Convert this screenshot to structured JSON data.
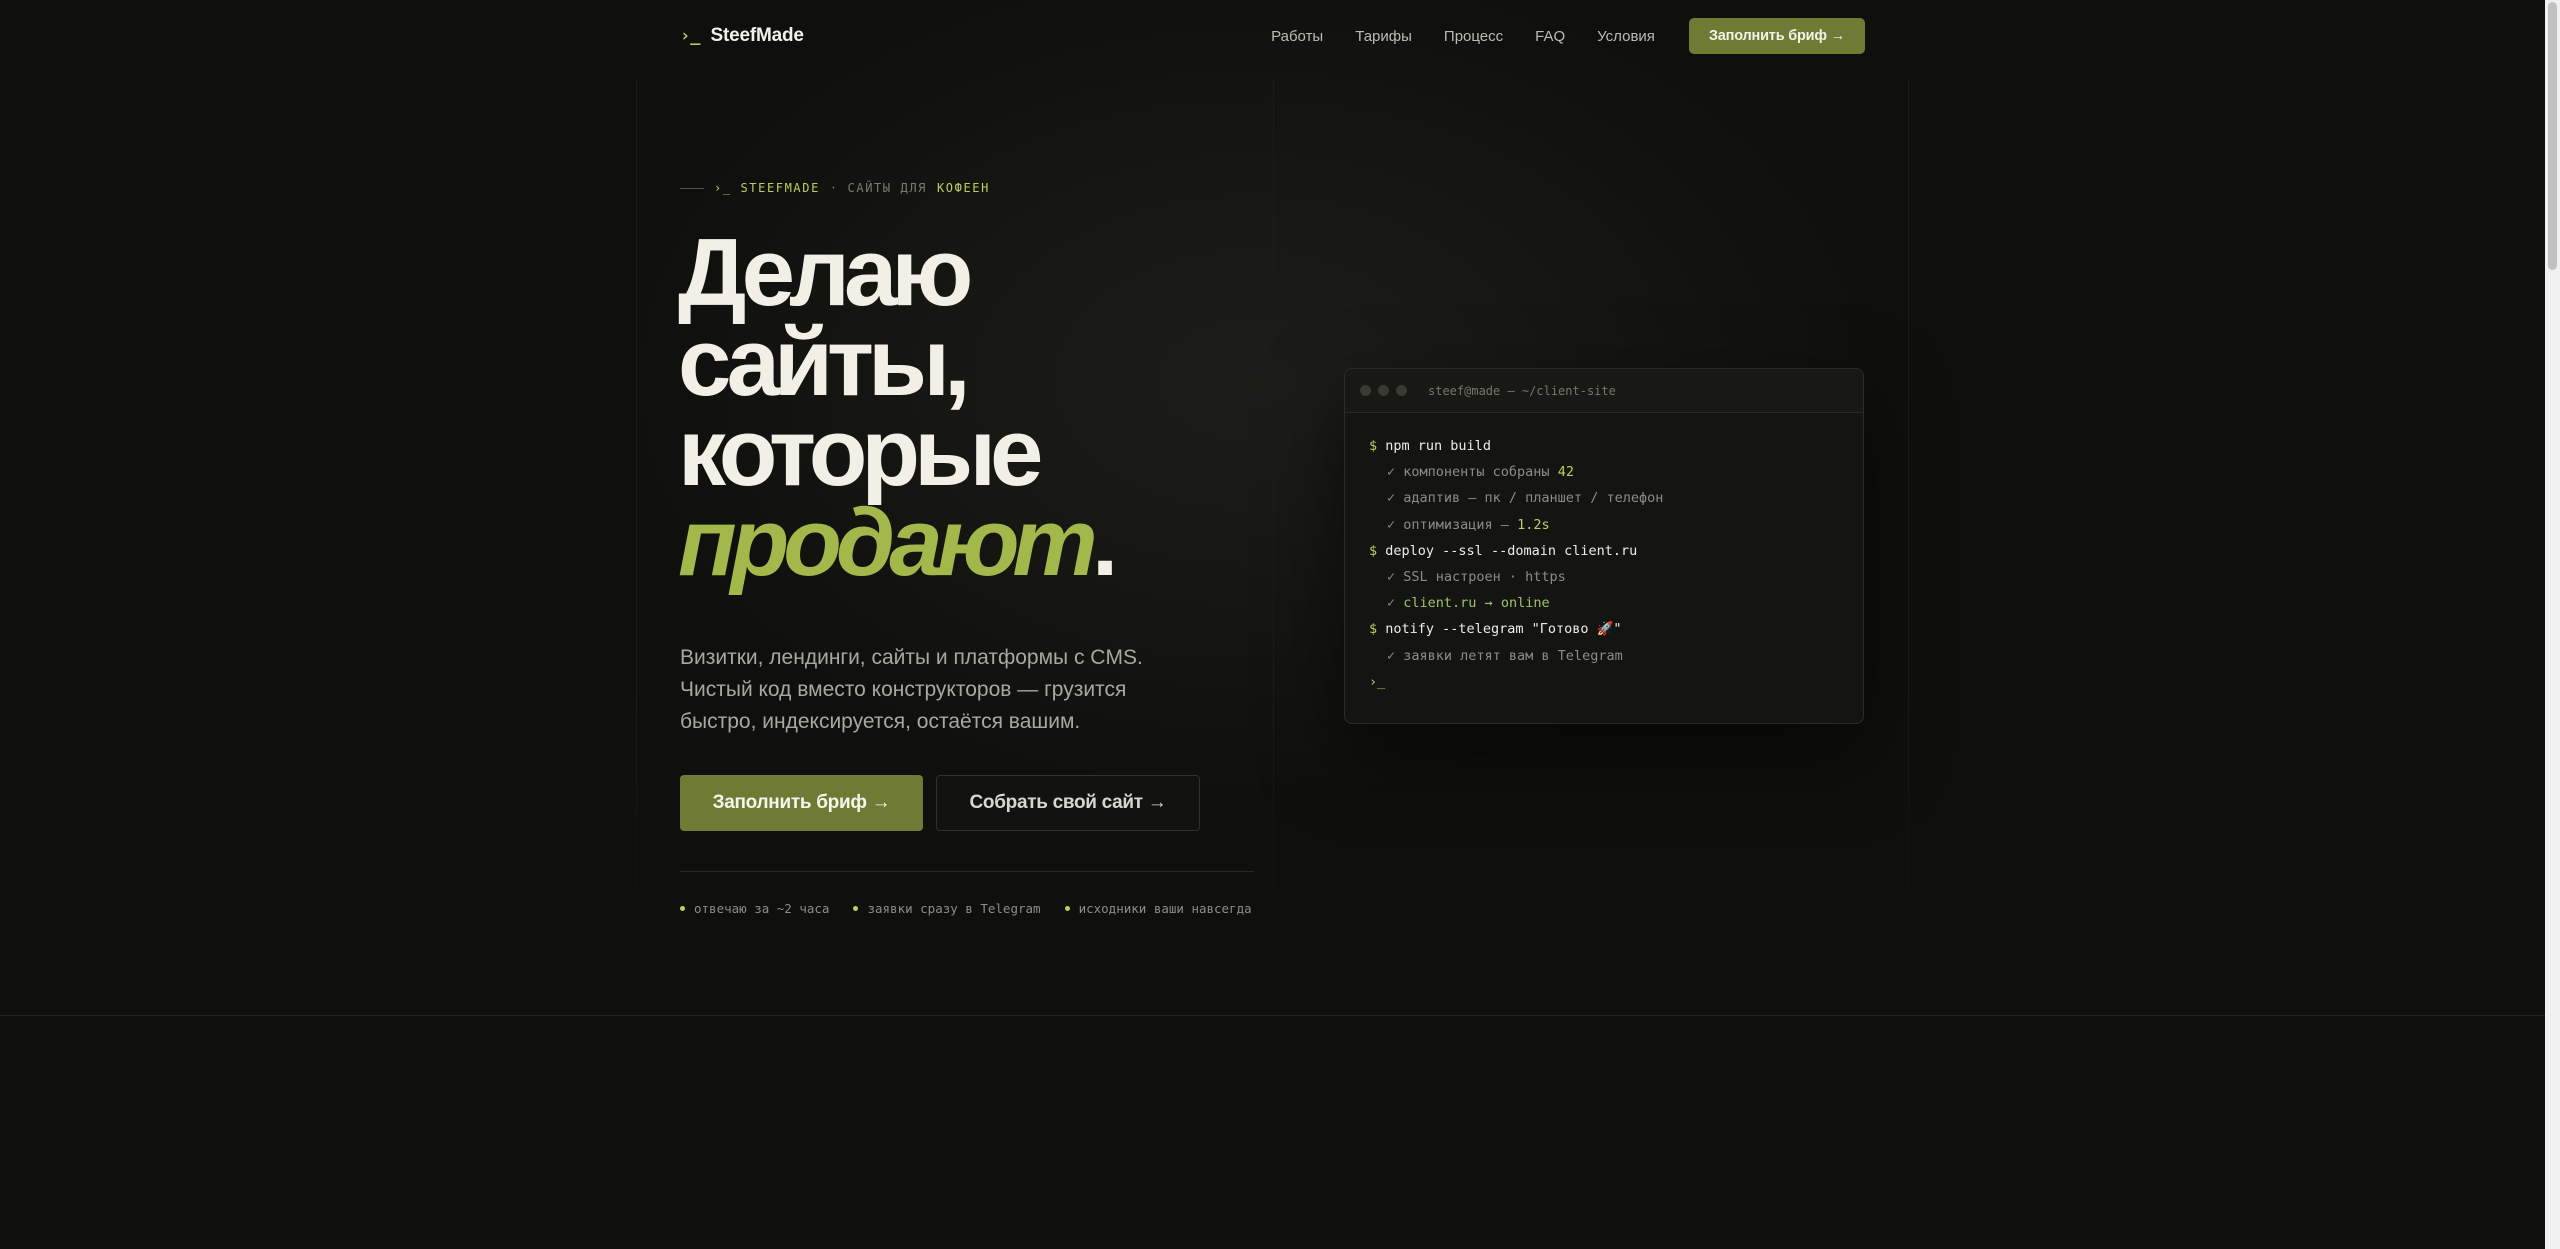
{
  "header": {
    "prompt": "›_",
    "brand": "SteefMade",
    "nav": [
      "Работы",
      "Тарифы",
      "Процесс",
      "FAQ",
      "Условия"
    ],
    "cta": "Заполнить бриф →"
  },
  "hero": {
    "eyebrow_prompt": "›_ STEEFMADE",
    "eyebrow_sep": "· САЙТЫ ДЛЯ",
    "eyebrow_accent": "КОФЕЕН",
    "title_lines": [
      "Делаю",
      "сайты,",
      "которые"
    ],
    "title_accent": "продают",
    "title_dot": ".",
    "subtitle": "Визитки, лендинги, сайты и платформы с CMS. Чистый код вместо конструкторов — грузится быстро, индексируется, остаётся вашим.",
    "primary_button": "Заполнить бриф →",
    "secondary_button": "Собрать свой сайт →",
    "badges": [
      "отвечаю за ~2 часа",
      "заявки сразу в Telegram",
      "исходники ваши навсегда"
    ]
  },
  "terminal": {
    "title": "steef@made — ~/client-site",
    "lines": {
      "c1_ps": "$",
      "c1": "npm run build",
      "l1": "✓ компоненты собраны",
      "l1v": "42",
      "l2": "✓ адаптив — пк / планшет / телефон",
      "l3": "✓ оптимизация —",
      "l3v": "1.2s",
      "c2_ps": "$",
      "c2": "deploy --ssl --domain client.ru",
      "l4": "✓ SSL настроен · https",
      "l5a": "✓",
      "l5": "client.ru → online",
      "c3_ps": "$",
      "c3": "notify --telegram \"Готово 🚀\"",
      "l6": "✓ заявки летят вам в Telegram",
      "cursor": "›_"
    }
  },
  "colors": {
    "background": "#0f0f0d",
    "accent": "#b9cf5e",
    "button": "#6f7b34",
    "title_accent": "#a2b84a"
  }
}
